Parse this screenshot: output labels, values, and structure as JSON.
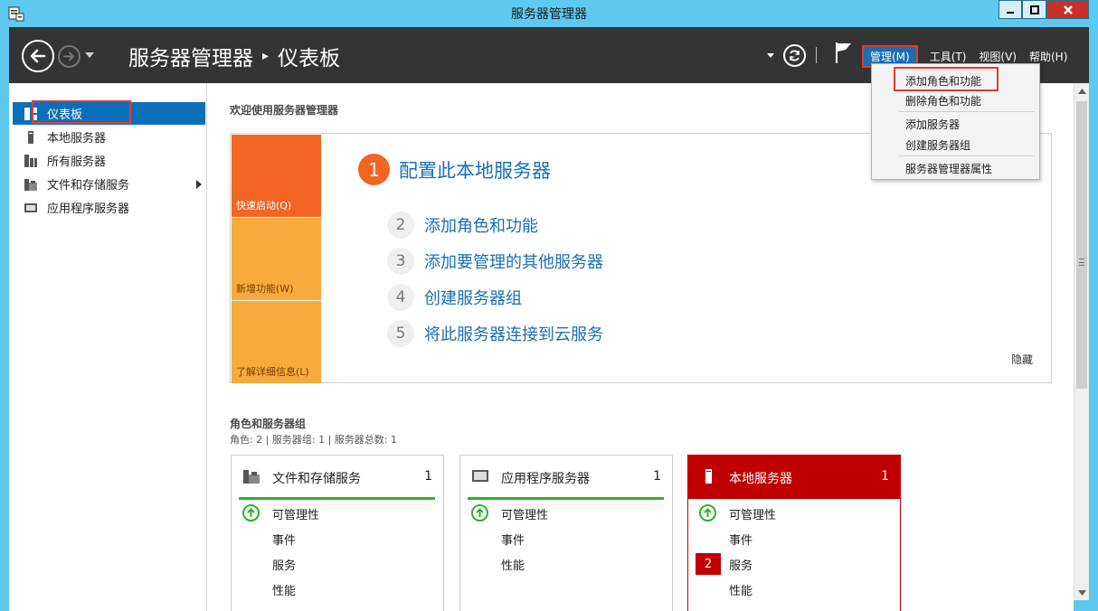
{
  "window": {
    "title": "服务器管理器"
  },
  "header": {
    "breadcrumb_app": "服务器管理器",
    "breadcrumb_sep": "▸",
    "breadcrumb_page": "仪表板",
    "menus": [
      {
        "label": "管理(M)",
        "active": true
      },
      {
        "label": "工具(T)"
      },
      {
        "label": "视图(V)"
      },
      {
        "label": "帮助(H)"
      }
    ]
  },
  "dropdown": {
    "items": [
      "添加角色和功能",
      "删除角色和功能",
      "添加服务器",
      "创建服务器组",
      "服务器管理器属性"
    ]
  },
  "sidebar": {
    "items": [
      {
        "label": "仪表板",
        "icon": "dashboard-icon",
        "selected": true
      },
      {
        "label": "本地服务器",
        "icon": "server-icon"
      },
      {
        "label": "所有服务器",
        "icon": "servers-icon"
      },
      {
        "label": "文件和存储服务",
        "icon": "file-storage-icon",
        "has_submenu": true
      },
      {
        "label": "应用程序服务器",
        "icon": "app-server-icon"
      }
    ]
  },
  "main": {
    "welcome": "欢迎使用服务器管理器",
    "tiles": {
      "quick": "快速启动(Q)",
      "new": "新增功能(W)",
      "learn": "了解详细信息(L)"
    },
    "steps": [
      {
        "num": "1",
        "text": "配置此本地服务器"
      },
      {
        "num": "2",
        "text": "添加角色和功能"
      },
      {
        "num": "3",
        "text": "添加要管理的其他服务器"
      },
      {
        "num": "4",
        "text": "创建服务器组"
      },
      {
        "num": "5",
        "text": "将此服务器连接到云服务"
      }
    ],
    "hide": "隐藏",
    "roles_title": "角色和服务器组",
    "roles_sub": "角色: 2 | 服务器组: 1 | 服务器总数: 1",
    "cards": [
      {
        "title": "文件和存储服务",
        "count": "1",
        "rows": [
          "可管理性",
          "事件",
          "服务",
          "性能"
        ]
      },
      {
        "title": "应用程序服务器",
        "count": "1",
        "rows": [
          "可管理性",
          "事件",
          "性能"
        ]
      },
      {
        "title": "本地服务器",
        "count": "1",
        "rows": [
          "可管理性",
          "事件",
          "服务",
          "性能"
        ],
        "badge": "2"
      }
    ]
  },
  "colors": {
    "accent_blue": "#0d6fb8",
    "orange": "#f26522",
    "light_orange": "#f7ab3c",
    "red": "#c00000",
    "green": "#2bb32b",
    "title_bar": "#5ec8ee",
    "header_bg": "#343434"
  }
}
